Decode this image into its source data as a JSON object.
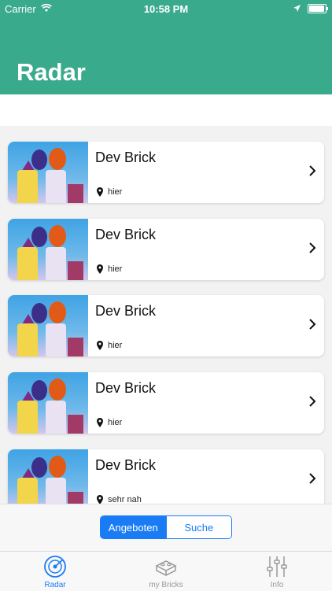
{
  "status_bar": {
    "carrier": "Carrier",
    "time": "10:58 PM"
  },
  "header": {
    "title": "Radar",
    "color": "#3aaa8c"
  },
  "items": [
    {
      "title": "Dev Brick",
      "location": "hier"
    },
    {
      "title": "Dev Brick",
      "location": "hier"
    },
    {
      "title": "Dev Brick",
      "location": "hier"
    },
    {
      "title": "Dev Brick",
      "location": "hier"
    },
    {
      "title": "Dev Brick",
      "location": "sehr nah"
    }
  ],
  "segmented": {
    "options": [
      "Angeboten",
      "Suche"
    ],
    "selected": "Angeboten"
  },
  "tabs": [
    {
      "label": "Radar",
      "icon": "radar-icon",
      "active": true
    },
    {
      "label": "my Bricks",
      "icon": "brick-icon",
      "active": false
    },
    {
      "label": "Info",
      "icon": "sliders-icon",
      "active": false
    }
  ],
  "accent_color": "#1a7cf4"
}
